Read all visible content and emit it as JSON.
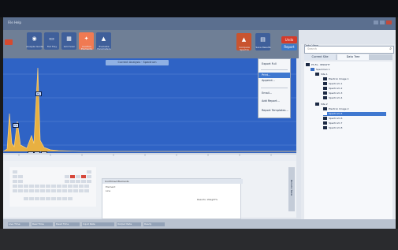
{
  "window": {
    "title": "File  Help"
  },
  "toolbar": {
    "tools": [
      {
        "label": "Analyze Guide",
        "icon": "analyze-icon"
      },
      {
        "label": "Full Tray",
        "icon": "tray-icon"
      },
      {
        "label": "Grid Scan",
        "icon": "grid-icon"
      },
      {
        "label": "Confirm Elements",
        "icon": "confirm-icon"
      },
      {
        "label": "Evaluate Parameters",
        "icon": "evaluate-icon"
      }
    ],
    "right_tools": [
      {
        "label": "Compare Spectra",
        "icon": "compare-icon"
      },
      {
        "label": "Save Results",
        "icon": "save-icon"
      }
    ],
    "red_button": "Undo",
    "blue_button": "Report"
  },
  "spectrum": {
    "header": "Current Analysis · Spectrum",
    "peak_labels": [
      "Fe",
      "Fe",
      "Cr",
      "Cr",
      "Ni",
      "Mn",
      "Si",
      "C",
      "O",
      "Al",
      "Ti",
      "Cu",
      "Zn",
      "Mo",
      "P"
    ]
  },
  "dropdown_menu": {
    "items": [
      "Export Full",
      "Print...",
      "Append...",
      "Email...",
      "Add Report...",
      "Report Templates..."
    ],
    "highlighted": "Print..."
  },
  "lower": {
    "selection_header": "Confirmed Elements",
    "selection_lines": [
      "Element",
      "Line"
    ],
    "right_note": "Results: Weight%",
    "buttons": [
      "Insert",
      "Clear"
    ]
  },
  "statusbar": {
    "items": [
      "Live Time",
      "Real Time",
      "Dead Time",
      "Input Rate",
      "Output Rate",
      "Ready"
    ]
  },
  "right_panel": {
    "search_placeholder": "Search",
    "header": "Data View",
    "tabs": [
      "Current Site",
      "Data Tree"
    ],
    "tree": [
      {
        "label": "Ph-Fe - INSIGHT",
        "level": 0
      },
      {
        "label": "Specimen 1",
        "level": 1
      },
      {
        "label": "Site 1",
        "level": 2
      },
      {
        "label": "Electron Image 1",
        "level": 3
      },
      {
        "label": "Spectrum 1",
        "level": 3
      },
      {
        "label": "Spectrum 2",
        "level": 3
      },
      {
        "label": "Spectrum 3",
        "level": 3
      },
      {
        "label": "Spectrum 4",
        "level": 3
      },
      {
        "label": "Site 2",
        "level": 2
      },
      {
        "label": "Electron Image 2",
        "level": 3
      },
      {
        "label": "Spectrum 5",
        "level": 3,
        "selected": true
      },
      {
        "label": "Spectrum 6",
        "level": 3
      },
      {
        "label": "Spectrum 7",
        "level": 3
      },
      {
        "label": "Spectrum 8",
        "level": 3
      }
    ]
  },
  "side_tab": "Periodic Table"
}
